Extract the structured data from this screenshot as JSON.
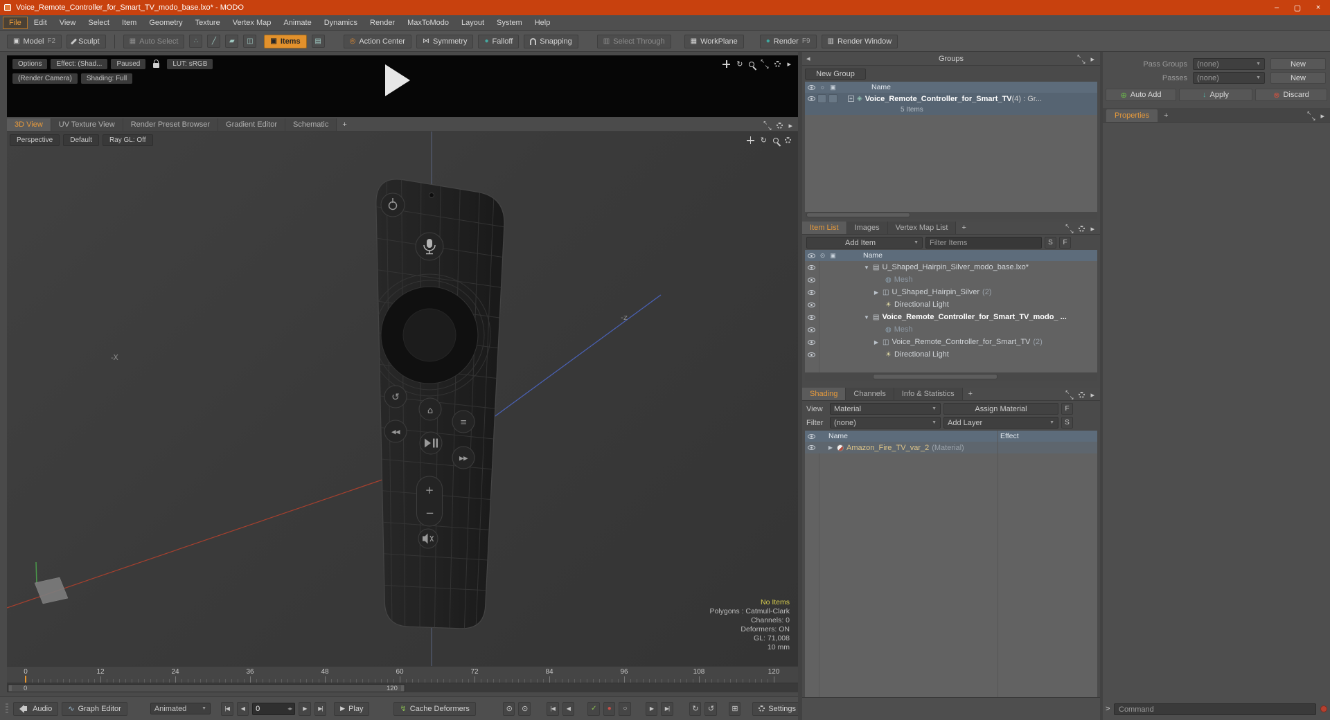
{
  "window": {
    "title": "Voice_Remote_Controller_for_Smart_TV_modo_base.lxo* - MODO",
    "minimize": "–",
    "maximize": "▢",
    "close": "×"
  },
  "menus": [
    "File",
    "Edit",
    "View",
    "Select",
    "Item",
    "Geometry",
    "Texture",
    "Vertex Map",
    "Animate",
    "Dynamics",
    "Render",
    "MaxToModo",
    "Layout",
    "System",
    "Help"
  ],
  "toolbar": {
    "model": "Model",
    "model_key": "F2",
    "sculpt": "Sculpt",
    "auto_select": "Auto Select",
    "items": "Items",
    "action_center": "Action Center",
    "symmetry": "Symmetry",
    "falloff": "Falloff",
    "snapping": "Snapping",
    "select_through": "Select Through",
    "workplane": "WorkPlane",
    "render": "Render",
    "render_key": "F9",
    "render_window": "Render Window"
  },
  "preview": {
    "options": "Options",
    "effect": "Effect: (Shad...",
    "paused": "Paused",
    "lut": "LUT: sRGB",
    "render_camera": "(Render Camera)",
    "shading": "Shading: Full"
  },
  "viewport_tabs": [
    "3D View",
    "UV Texture View",
    "Render Preset Browser",
    "Gradient Editor",
    "Schematic",
    "+"
  ],
  "viewport": {
    "mode": "Perspective",
    "style": "Default",
    "raygl": "Ray GL: Off",
    "neg_x": "-X",
    "neg_z": "-z",
    "info": [
      "No Items",
      "Polygons : Catmull-Clark",
      "Channels: 0",
      "Deformers: ON",
      "GL: 71,008",
      "10 mm"
    ]
  },
  "timeline": {
    "labels": [
      "0",
      "12",
      "24",
      "36",
      "48",
      "60",
      "72",
      "84",
      "96",
      "108",
      "120"
    ],
    "range_start": "0",
    "range_end": "120"
  },
  "transport": {
    "audio": "Audio",
    "graph_editor": "Graph Editor",
    "animated": "Animated",
    "frame": "0",
    "play": "Play",
    "cache_deformers": "Cache Deformers",
    "settings": "Settings"
  },
  "groups": {
    "title": "Groups",
    "new_group": "New Group",
    "name_col": "Name",
    "row_label": "Voice_Remote_Controller_for_Smart_TV",
    "row_suffix": " (4) : Gr...",
    "row_sub": "5 Items"
  },
  "passes": {
    "pass_groups_label": "Pass Groups",
    "pass_groups_value": "(none)",
    "new1": "New",
    "passes_label": "Passes",
    "passes_value": "(none)",
    "new2": "New",
    "auto_add": "Auto Add",
    "apply": "Apply",
    "discard": "Discard",
    "properties_tab": "Properties",
    "add_tab": "+"
  },
  "itemlist": {
    "tabs": [
      "Item List",
      "Images",
      "Vertex Map List",
      "+"
    ],
    "add_item": "Add Item",
    "filter_placeholder": "Filter Items",
    "s": "S",
    "f": "F",
    "name_col": "Name",
    "rows": [
      {
        "label": "U_Shaped_Hairpin_Silver_modo_base.lxo*",
        "suffix": ""
      },
      {
        "label": "Mesh",
        "suffix": ""
      },
      {
        "label": "U_Shaped_Hairpin_Silver",
        "suffix": " (2)"
      },
      {
        "label": "Directional Light",
        "suffix": ""
      },
      {
        "label": "Voice_Remote_Controller_for_Smart_TV_modo_ ...",
        "suffix": ""
      },
      {
        "label": "Mesh",
        "suffix": ""
      },
      {
        "label": "Voice_Remote_Controller_for_Smart_TV",
        "suffix": " (2)"
      },
      {
        "label": "Directional Light",
        "suffix": ""
      }
    ]
  },
  "shading": {
    "tabs": [
      "Shading",
      "Channels",
      "Info & Statistics",
      "+"
    ],
    "view_label": "View",
    "view_value": "Material",
    "assign": "Assign Material",
    "f": "F",
    "filter_label": "Filter",
    "filter_value": "(none)",
    "add_layer": "Add Layer",
    "s": "S",
    "name_col": "Name",
    "effect_col": "Effect",
    "material": "Amazon_Fire_TV_var_2",
    "material_suffix": " (Material)"
  },
  "command": {
    "prompt": ">",
    "placeholder": "Command"
  },
  "icons": {
    "caret_down": "▼",
    "caret_left": "◂",
    "caret_right": "▸",
    "expander_open": "▼",
    "expander_closed": "▶",
    "plus": "+",
    "minus": "−",
    "rotate": "↻",
    "loop": "↺",
    "skip_start": "|◀",
    "step_back": "◀",
    "step_fwd": "▶",
    "skip_end": "▶|",
    "play": "▶",
    "record": "●",
    "circled_dot": "⊙",
    "check": "✓",
    "small_circle": "○",
    "grid": "⊞",
    "add_circle": "⊕",
    "remove_circle": "⊗",
    "down_arrow": "↓",
    "bolt": "↯",
    "wave": "∿",
    "cube": "▣",
    "cube_grid": "▦",
    "target": "◎",
    "bowtie": "⋈",
    "dot": "●",
    "group": "◈",
    "scene": "▤",
    "mesh": "◍",
    "sun": "☀",
    "square_pair": "◫",
    "vertices": "∴",
    "edge": "╱",
    "polygon": "▰",
    "render_window": "▥",
    "home": "⌂",
    "menu_lines": "≡",
    "rewind": "◀◀",
    "fast_forward": "▶▶",
    "spin": "◂▸"
  }
}
